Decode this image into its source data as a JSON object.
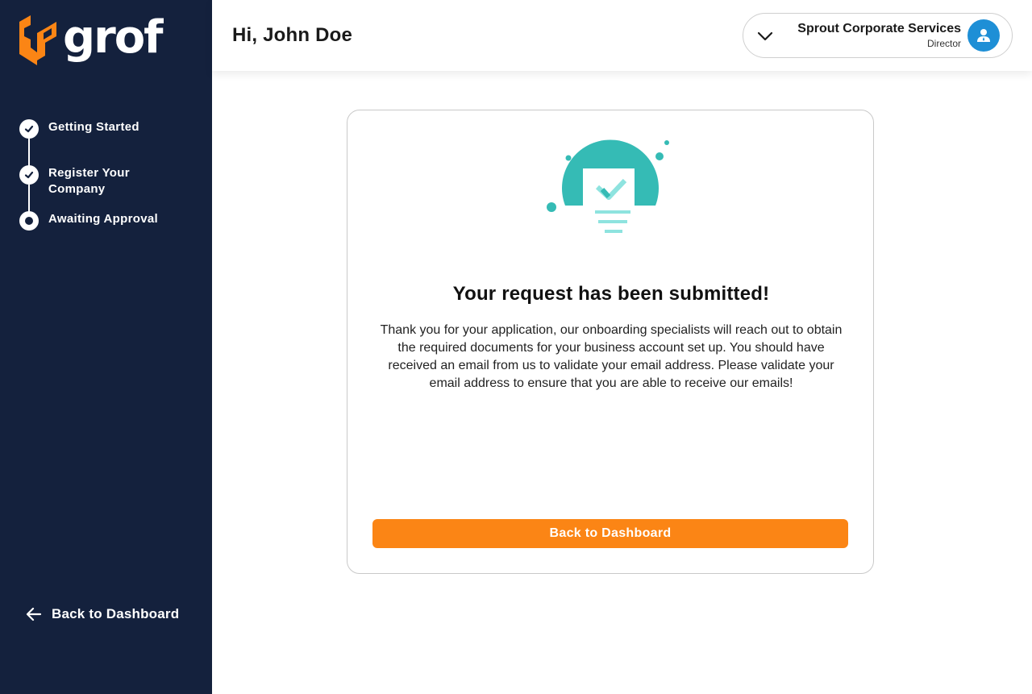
{
  "brand": {
    "name": "grof",
    "accent": "#fb8515",
    "sidebar_bg": "#14213d"
  },
  "sidebar": {
    "steps": [
      {
        "label": "Getting Started",
        "state": "done"
      },
      {
        "label": "Register Your Company",
        "state": "done"
      },
      {
        "label": "Awaiting Approval",
        "state": "current"
      }
    ],
    "back_label": "Back to Dashboard"
  },
  "header": {
    "greeting": "Hi, John Doe",
    "account": {
      "name": "Sprout Corporate Services",
      "role": "Director"
    }
  },
  "card": {
    "title": "Your request has been submitted!",
    "body": "Thank you for your application, our onboarding specialists will reach out to obtain the required documents for your business account set up. You should have received an email from us to validate your email address. Please validate your email address to ensure that you are able to receive our emails!",
    "button_label": "Back to Dashboard"
  },
  "icons": {
    "logo": "grof-logo-icon",
    "step_done": "check-icon",
    "step_current": "current-step-icon",
    "back": "arrow-left-icon",
    "dropdown": "chevron-down-icon",
    "avatar": "user-avatar-icon",
    "illustration": "submitted-document-icon"
  }
}
